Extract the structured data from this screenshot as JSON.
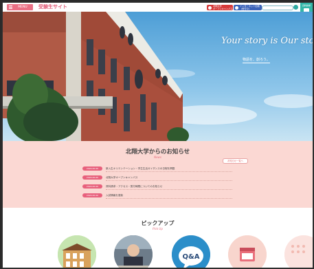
{
  "header": {
    "menu_label": "MENU",
    "site_title": "受験生サイト",
    "pill_red": "北翔大学\nオープンキャンパス",
    "pill_blue": "インターネット出願\n（受付中）",
    "badge_label": "資料請求"
  },
  "hero": {
    "tagline": "Your story is Our story",
    "tagline_sub": "物語を、創ろう。"
  },
  "news": {
    "title": "北翔大学からのお知らせ",
    "subtitle": "News",
    "more_label": "お知らせ一覧へ",
    "items": [
      {
        "tag": "2024.00.00",
        "text": "新入生オリエンテーション・学生生活ガイダンスの日程を掲載"
      },
      {
        "tag": "2024.00.00",
        "text": "北翔大学オープンキャンパス"
      },
      {
        "tag": "2024.00.00",
        "text": "資料請求・アクセス・受付時間についてのお知らせ"
      },
      {
        "tag": "2024.00.00",
        "text": "入試情報を更新"
      }
    ]
  },
  "pickup": {
    "title": "ピックアップ",
    "subtitle": "Pick Up",
    "qa_label": "Q&A"
  },
  "colors": {
    "accent_pink": "#e96f84",
    "news_bg": "#fbd8d3",
    "teal": "#33b6a8"
  }
}
